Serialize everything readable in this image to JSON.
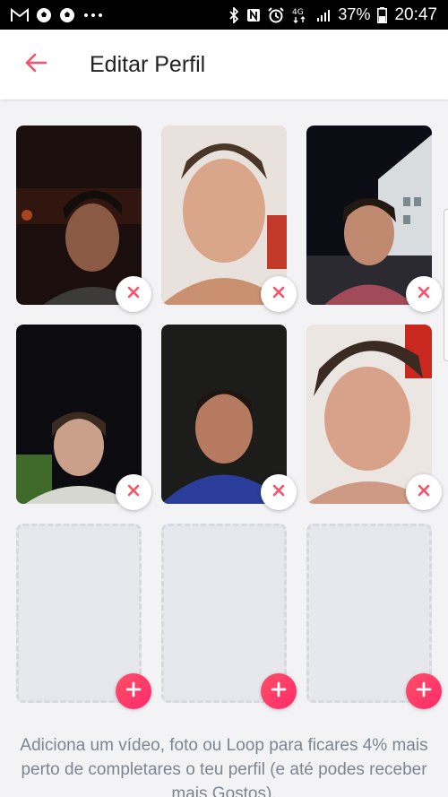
{
  "status_bar": {
    "left_icons": [
      "gmail-icon",
      "soccer-ball-icon",
      "soccer-ball-icon",
      "more-dots-icon"
    ],
    "right_icons": [
      "bluetooth-icon",
      "nfc-icon",
      "alarm-icon",
      "4g-icon",
      "signal-icon",
      "battery-icon"
    ],
    "network": "4G",
    "battery": "37%",
    "time": "20:47"
  },
  "app_bar": {
    "title": "Editar Perfil",
    "back_icon": "back-arrow-icon"
  },
  "colors": {
    "accent": "#fd5068",
    "accent_end": "#ff2a6a",
    "empty_slot": "#e6e8ee",
    "hint_text": "#7c8592"
  },
  "photo_grid": {
    "photos": [
      {
        "slot": 1,
        "action_icon": "remove-icon"
      },
      {
        "slot": 2,
        "action_icon": "remove-icon"
      },
      {
        "slot": 3,
        "action_icon": "remove-icon"
      },
      {
        "slot": 4,
        "action_icon": "remove-icon"
      },
      {
        "slot": 5,
        "action_icon": "remove-icon"
      },
      {
        "slot": 6,
        "action_icon": "remove-icon"
      }
    ],
    "empty_slots": [
      {
        "slot": 7,
        "action_icon": "add-icon"
      },
      {
        "slot": 8,
        "action_icon": "add-icon"
      },
      {
        "slot": 9,
        "action_icon": "add-icon"
      }
    ]
  },
  "hint": {
    "text": "Adiciona um vídeo, foto ou Loop para ficares 4% mais perto de completares o teu perfil (e até podes receber mais Gostos)."
  }
}
